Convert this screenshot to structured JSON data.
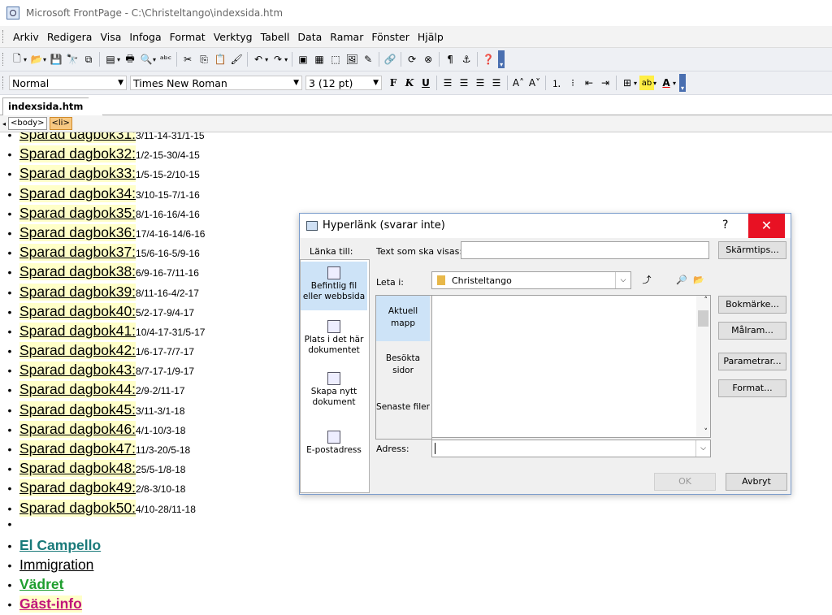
{
  "window": {
    "title": "Microsoft FrontPage - C:\\Christeltango\\indexsida.htm"
  },
  "menubar": [
    "Arkiv",
    "Redigera",
    "Visa",
    "Infoga",
    "Format",
    "Verktyg",
    "Tabell",
    "Data",
    "Ramar",
    "Fönster",
    "Hjälp"
  ],
  "formatting": {
    "style": "Normal",
    "font": "Times New Roman",
    "size": "3 (12 pt)"
  },
  "document_tab": "indexsida.htm",
  "tags": [
    "<body>",
    "<li>"
  ],
  "diary": [
    {
      "link": "Sparad dagbok31:",
      "dates": "3/11-14-31/1-15"
    },
    {
      "link": "Sparad dagbok32:",
      "dates": "1/2-15-30/4-15"
    },
    {
      "link": "Sparad dagbok33:",
      "dates": "1/5-15-2/10-15"
    },
    {
      "link": "Sparad dagbok34:",
      "dates": "3/10-15-7/1-16"
    },
    {
      "link": "Sparad dagbok35:",
      "dates": "8/1-16-16/4-16"
    },
    {
      "link": "Sparad dagbok36:",
      "dates": "17/4-16-14/6-16"
    },
    {
      "link": "Sparad dagbok37:",
      "dates": "15/6-16-5/9-16"
    },
    {
      "link": "Sparad dagbok38:",
      "dates": "6/9-16-7/11-16"
    },
    {
      "link": "Sparad dagbok39:",
      "dates": "8/11-16-4/2-17"
    },
    {
      "link": "Sparad dagbok40:",
      "dates": "5/2-17-9/4-17"
    },
    {
      "link": "Sparad dagbok41:",
      "dates": "10/4-17-31/5-17"
    },
    {
      "link": "Sparad dagbok42:",
      "dates": "1/6-17-7/7-17"
    },
    {
      "link": "Sparad dagbok43:",
      "dates": "8/7-17-1/9-17"
    },
    {
      "link": "Sparad dagbok44:",
      "dates": "2/9-2/11-17"
    },
    {
      "link": "Sparad dagbok45:",
      "dates": "3/11-3/1-18"
    },
    {
      "link": "Sparad dagbok46:",
      "dates": "4/1-10/3-18"
    },
    {
      "link": "Sparad dagbok47:",
      "dates": "11/3-20/5-18"
    },
    {
      "link": "Sparad dagbok48:",
      "dates": "25/5-1/8-18"
    },
    {
      "link": "Sparad dagbok49:",
      "dates": "2/8-3/10-18"
    },
    {
      "link": "Sparad dagbok50:",
      "dates": "4/10-28/11-18"
    }
  ],
  "extra_links": [
    {
      "label": "El Campello",
      "color": "#1a7a7a",
      "bold": true,
      "bg": ""
    },
    {
      "label": "Immigration",
      "color": "#000000",
      "bold": false,
      "bg": ""
    },
    {
      "label": "Vädret",
      "color": "#1e9e2e",
      "bold": true,
      "bg": ""
    },
    {
      "label": "Gäst-info",
      "color": "#c0147a",
      "bold": true,
      "bg": "#ffffc8"
    }
  ],
  "dialog": {
    "title": "Hyperlänk (svarar inte)",
    "help": "?",
    "link_to_label": "Länka till:",
    "text_label": "Text som ska visas:",
    "text_value": "",
    "screentip_button": "Skärmtips...",
    "look_in_label": "Leta i:",
    "look_in_value": "Christeltango",
    "link_targets": [
      "Befintlig fil eller webbsida",
      "Plats i det här dokumentet",
      "Skapa nytt dokument",
      "E-postadress"
    ],
    "side_items": [
      "Aktuell mapp",
      "Besökta sidor",
      "Senaste filer"
    ],
    "right_buttons": [
      "Bokmärke...",
      "Målram...",
      "Parametrar...",
      "Format..."
    ],
    "address_label": "Adress:",
    "address_value": "",
    "ok": "OK",
    "cancel": "Avbryt"
  }
}
